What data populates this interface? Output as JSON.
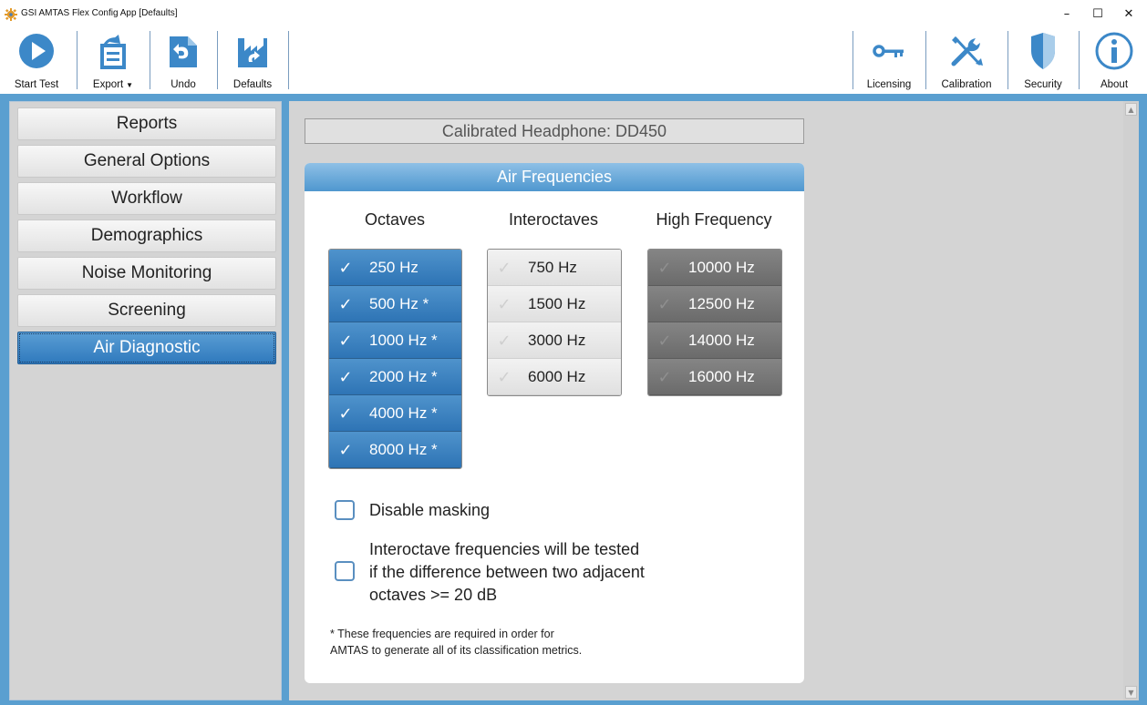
{
  "window": {
    "title": "GSI AMTAS Flex Config App [Defaults]",
    "minimize_glyph": "–",
    "maximize_glyph": "☐",
    "close_glyph": "✕",
    "app_icon": "gear-icon"
  },
  "toolbar": {
    "left": [
      {
        "label": "Start Test",
        "icon": "play-icon"
      },
      {
        "label": "Export",
        "icon": "export-icon",
        "dropdown": true
      },
      {
        "label": "Undo",
        "icon": "undo-icon"
      },
      {
        "label": "Defaults",
        "icon": "factory-icon"
      }
    ],
    "right": [
      {
        "label": "Licensing",
        "icon": "key-icon"
      },
      {
        "label": "Calibration",
        "icon": "tools-icon"
      },
      {
        "label": "Security",
        "icon": "shield-icon"
      },
      {
        "label": "About",
        "icon": "info-icon"
      }
    ],
    "dropdown_caret": "▼"
  },
  "sidebar": {
    "items": [
      {
        "label": "Reports",
        "active": false
      },
      {
        "label": "General Options",
        "active": false
      },
      {
        "label": "Workflow",
        "active": false
      },
      {
        "label": "Demographics",
        "active": false
      },
      {
        "label": "Noise Monitoring",
        "active": false
      },
      {
        "label": "Screening",
        "active": false
      },
      {
        "label": "Air Diagnostic",
        "active": true
      }
    ]
  },
  "main": {
    "calibrated_headphone": "Calibrated Headphone: DD450",
    "panel_title": "Air Frequencies",
    "columns": {
      "octaves": {
        "title": "Octaves",
        "items": [
          {
            "label": "250 Hz",
            "checked": true
          },
          {
            "label": "500 Hz *",
            "checked": true
          },
          {
            "label": "1000 Hz *",
            "checked": true
          },
          {
            "label": "2000 Hz *",
            "checked": true
          },
          {
            "label": "4000 Hz *",
            "checked": true
          },
          {
            "label": "8000 Hz *",
            "checked": true
          }
        ]
      },
      "interoctaves": {
        "title": "Interoctaves",
        "items": [
          {
            "label": "750 Hz",
            "checked": false
          },
          {
            "label": "1500 Hz",
            "checked": false
          },
          {
            "label": "3000 Hz",
            "checked": false
          },
          {
            "label": "6000 Hz",
            "checked": false
          }
        ]
      },
      "high_frequency": {
        "title": "High Frequency",
        "items": [
          {
            "label": "10000 Hz",
            "checked": false
          },
          {
            "label": "12500 Hz",
            "checked": false
          },
          {
            "label": "14000 Hz",
            "checked": false
          },
          {
            "label": "16000 Hz",
            "checked": false
          }
        ]
      }
    },
    "check_glyph": "✓",
    "disable_masking": {
      "label": "Disable masking",
      "checked": false
    },
    "interoctave_rule": {
      "lines": [
        "Interoctave frequencies will be tested",
        "if the difference between two adjacent",
        "octaves >= 20 dB"
      ],
      "checked": false
    },
    "footnote": [
      "* These frequencies are required in order for",
      "AMTAS to generate all of its classification metrics."
    ]
  },
  "colors": {
    "accent": "#2e74b5",
    "workspace_bg": "#5a9fd0",
    "panel_header": "#5a9fd3",
    "high_freq_disabled": "#737373"
  }
}
